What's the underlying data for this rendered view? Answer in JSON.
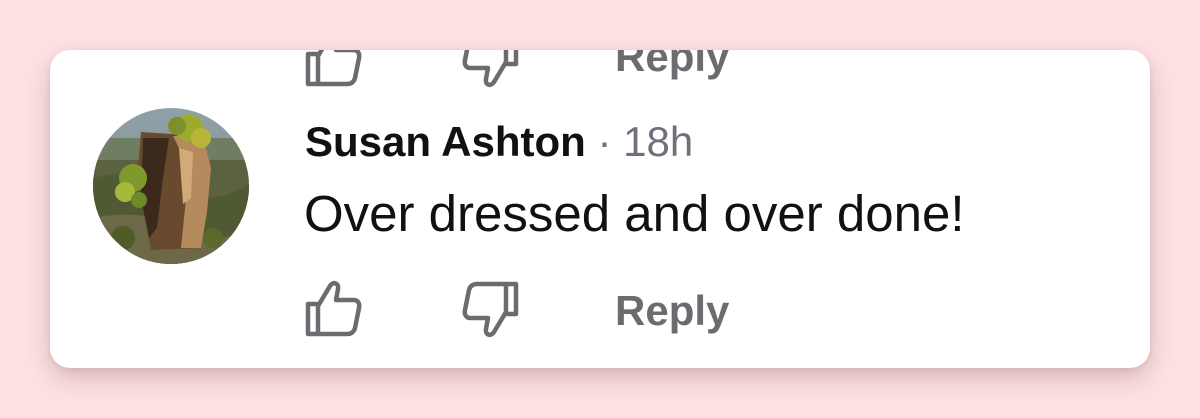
{
  "previous_comment": {
    "reply_label": "Reply"
  },
  "comment": {
    "author": "Susan Ashton",
    "separator": " · ",
    "timestamp": "18h",
    "text": "Over dressed and over done!",
    "avatar_icon": "profile-photo-tree-stump",
    "reply_label": "Reply"
  },
  "icons": {
    "like": "thumbs-up-icon",
    "dislike": "thumbs-down-icon"
  },
  "colors": {
    "background": "#fde1e3",
    "card": "#ffffff",
    "author_text": "#111111",
    "meta_text": "#70707a",
    "action_gray": "#6b6b70"
  }
}
